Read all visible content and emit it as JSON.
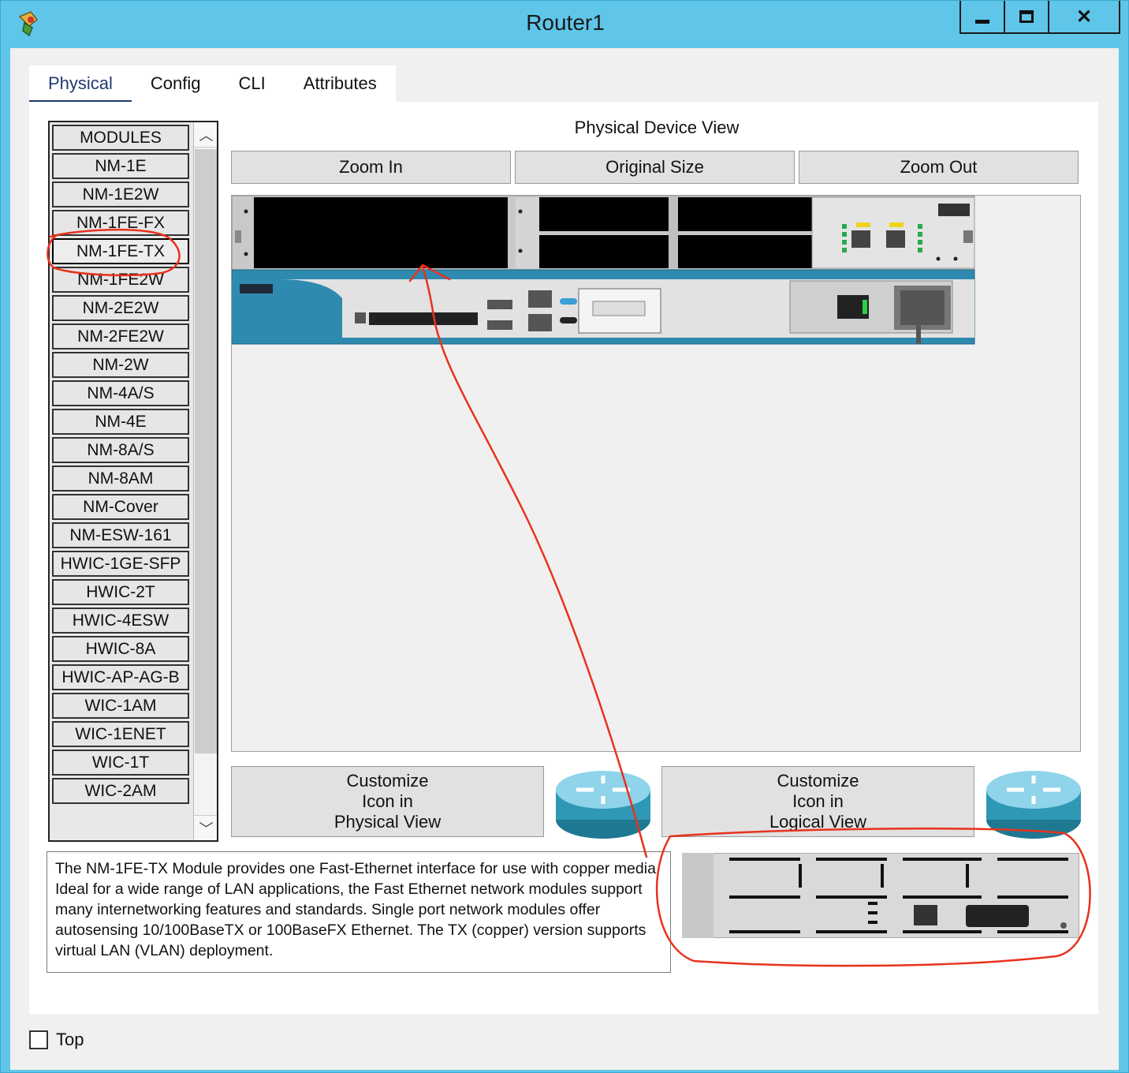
{
  "window": {
    "title": "Router1"
  },
  "tabs": [
    {
      "label": "Physical"
    },
    {
      "label": "Config"
    },
    {
      "label": "CLI"
    },
    {
      "label": "Attributes"
    }
  ],
  "modules": {
    "items": [
      "MODULES",
      "NM-1E",
      "NM-1E2W",
      "NM-1FE-FX",
      "NM-1FE-TX",
      "NM-1FE2W",
      "NM-2E2W",
      "NM-2FE2W",
      "NM-2W",
      "NM-4A/S",
      "NM-4E",
      "NM-8A/S",
      "NM-8AM",
      "NM-Cover",
      "NM-ESW-161",
      "HWIC-1GE-SFP",
      "HWIC-2T",
      "HWIC-4ESW",
      "HWIC-8A",
      "HWIC-AP-AG-B",
      "WIC-1AM",
      "WIC-1ENET",
      "WIC-1T",
      "WIC-2AM"
    ],
    "selected": "NM-1FE-TX"
  },
  "device_view": {
    "title": "Physical Device View",
    "zoom_in": "Zoom In",
    "original_size": "Original Size",
    "zoom_out": "Zoom Out"
  },
  "customize": {
    "physical": "Customize\nIcon in\nPhysical View",
    "logical": "Customize\nIcon in\nLogical View"
  },
  "description": "The NM-1FE-TX Module provides one Fast-Ethernet interface for use with copper media. Ideal for a wide range of LAN applications, the Fast Ethernet network modules support many internetworking features and standards. Single port network modules offer autosensing 10/100BaseTX or 100BaseFX Ethernet. The TX (copper) version supports virtual LAN (VLAN) deployment.",
  "top_checkbox": {
    "label": "Top",
    "checked": false
  },
  "annotation_color": "#e8321e"
}
